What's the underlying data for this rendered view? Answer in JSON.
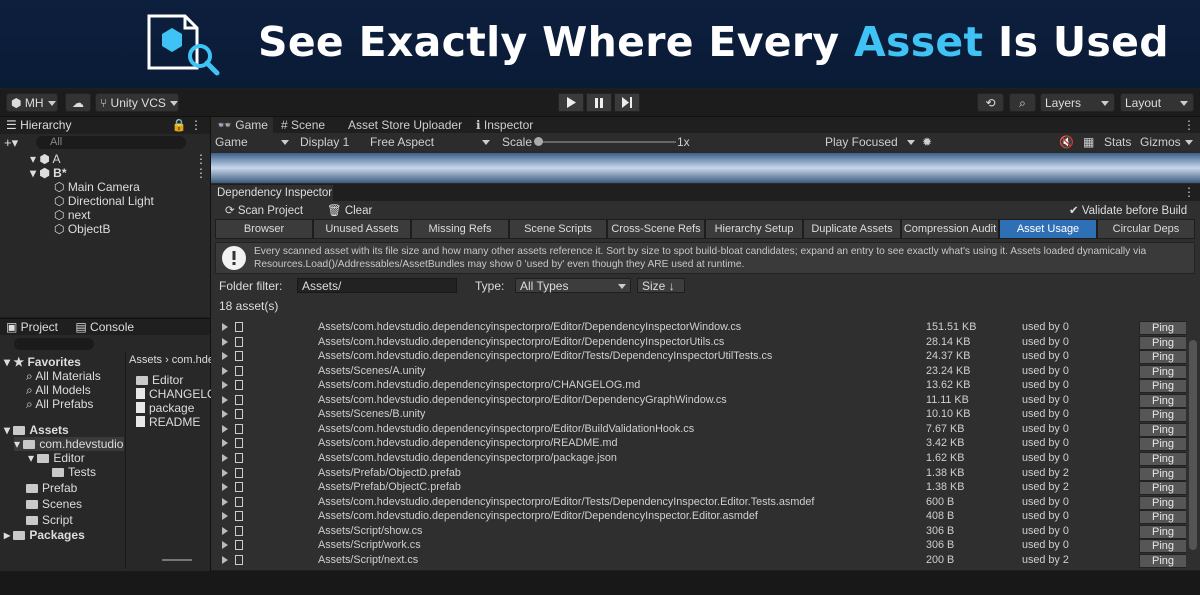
{
  "banner": {
    "title_pre": "See Exactly Where Every ",
    "title_accent": "Asset",
    "title_post": " Is Used",
    "accent_color": "#3fc3f5"
  },
  "toolbar": {
    "account": "MH",
    "vcs": "Unity VCS",
    "layers": "Layers",
    "layout": "Layout"
  },
  "hierarchy": {
    "tab": "Hierarchy",
    "search_placeholder": "All",
    "items": [
      "A",
      "B*",
      "Main Camera",
      "Directional Light",
      "next",
      "ObjectB"
    ]
  },
  "project": {
    "tabs": [
      "Project",
      "Console"
    ],
    "favorites_label": "Favorites",
    "favorites": [
      "All Materials",
      "All Models",
      "All Prefabs"
    ],
    "assets_label": "Assets",
    "tree": [
      "com.hdevstudio...",
      "Editor",
      "Tests",
      "Prefab",
      "Scenes",
      "Script"
    ],
    "packages_label": "Packages",
    "breadcrumb": [
      "Assets",
      "com.hdev"
    ],
    "files": [
      "Editor",
      "CHANGELOG",
      "package",
      "README"
    ]
  },
  "game": {
    "tabs": [
      "Game",
      "Scene",
      "Asset Store Uploader",
      "Inspector"
    ],
    "view_mode": "Game",
    "display": "Display 1",
    "aspect": "Free Aspect",
    "scale_label": "Scale",
    "scale_value": "1x",
    "play_mode": "Play Focused",
    "stats": "Stats",
    "gizmos": "Gizmos"
  },
  "dependency": {
    "window_title": "Dependency Inspector",
    "scan_button": "Scan Project",
    "clear_button": "Clear",
    "validate_label": "Validate before Build",
    "validate_checked": true,
    "tabs": [
      "Browser",
      "Unused Assets",
      "Missing Refs",
      "Scene Scripts",
      "Cross-Scene Refs",
      "Hierarchy Setup",
      "Duplicate Assets",
      "Compression Audit",
      "Asset Usage",
      "Circular Deps"
    ],
    "active_tab": "Asset Usage",
    "info_text": "Every scanned asset with its file size and how many other assets reference it. Sort by size to spot build-bloat candidates; expand an entry to see exactly what's using it. Assets loaded dynamically via Resources.Load()/Addressables/AssetBundles may show 0 'used by' even though they ARE used at runtime.",
    "folder_filter_label": "Folder filter:",
    "folder_filter_value": "Assets/",
    "type_label": "Type:",
    "type_value": "All Types",
    "sort_label": "Size",
    "count_text": "18 asset(s)",
    "ping_label": "Ping",
    "assets": [
      {
        "path": "Assets/com.hdevstudio.dependencyinspectorpro/Editor/DependencyInspectorWindow.cs",
        "size": "151.51 KB",
        "used": "used by 0"
      },
      {
        "path": "Assets/com.hdevstudio.dependencyinspectorpro/Editor/DependencyInspectorUtils.cs",
        "size": "28.14 KB",
        "used": "used by 0"
      },
      {
        "path": "Assets/com.hdevstudio.dependencyinspectorpro/Editor/Tests/DependencyInspectorUtilTests.cs",
        "size": "24.37 KB",
        "used": "used by 0"
      },
      {
        "path": "Assets/Scenes/A.unity",
        "size": "23.24 KB",
        "used": "used by 0"
      },
      {
        "path": "Assets/com.hdevstudio.dependencyinspectorpro/CHANGELOG.md",
        "size": "13.62 KB",
        "used": "used by 0"
      },
      {
        "path": "Assets/com.hdevstudio.dependencyinspectorpro/Editor/DependencyGraphWindow.cs",
        "size": "11.11 KB",
        "used": "used by 0"
      },
      {
        "path": "Assets/Scenes/B.unity",
        "size": "10.10 KB",
        "used": "used by 0"
      },
      {
        "path": "Assets/com.hdevstudio.dependencyinspectorpro/Editor/BuildValidationHook.cs",
        "size": "7.67 KB",
        "used": "used by 0"
      },
      {
        "path": "Assets/com.hdevstudio.dependencyinspectorpro/README.md",
        "size": "3.42 KB",
        "used": "used by 0"
      },
      {
        "path": "Assets/com.hdevstudio.dependencyinspectorpro/package.json",
        "size": "1.62 KB",
        "used": "used by 0"
      },
      {
        "path": "Assets/Prefab/ObjectD.prefab",
        "size": "1.38 KB",
        "used": "used by 2"
      },
      {
        "path": "Assets/Prefab/ObjectC.prefab",
        "size": "1.38 KB",
        "used": "used by 2"
      },
      {
        "path": "Assets/com.hdevstudio.dependencyinspectorpro/Editor/Tests/DependencyInspector.Editor.Tests.asmdef",
        "size": "600 B",
        "used": "used by 0"
      },
      {
        "path": "Assets/com.hdevstudio.dependencyinspectorpro/Editor/DependencyInspector.Editor.asmdef",
        "size": "408 B",
        "used": "used by 0"
      },
      {
        "path": "Assets/Script/show.cs",
        "size": "306 B",
        "used": "used by 0"
      },
      {
        "path": "Assets/Script/work.cs",
        "size": "306 B",
        "used": "used by 0"
      },
      {
        "path": "Assets/Script/next.cs",
        "size": "200 B",
        "used": "used by 2"
      }
    ]
  }
}
